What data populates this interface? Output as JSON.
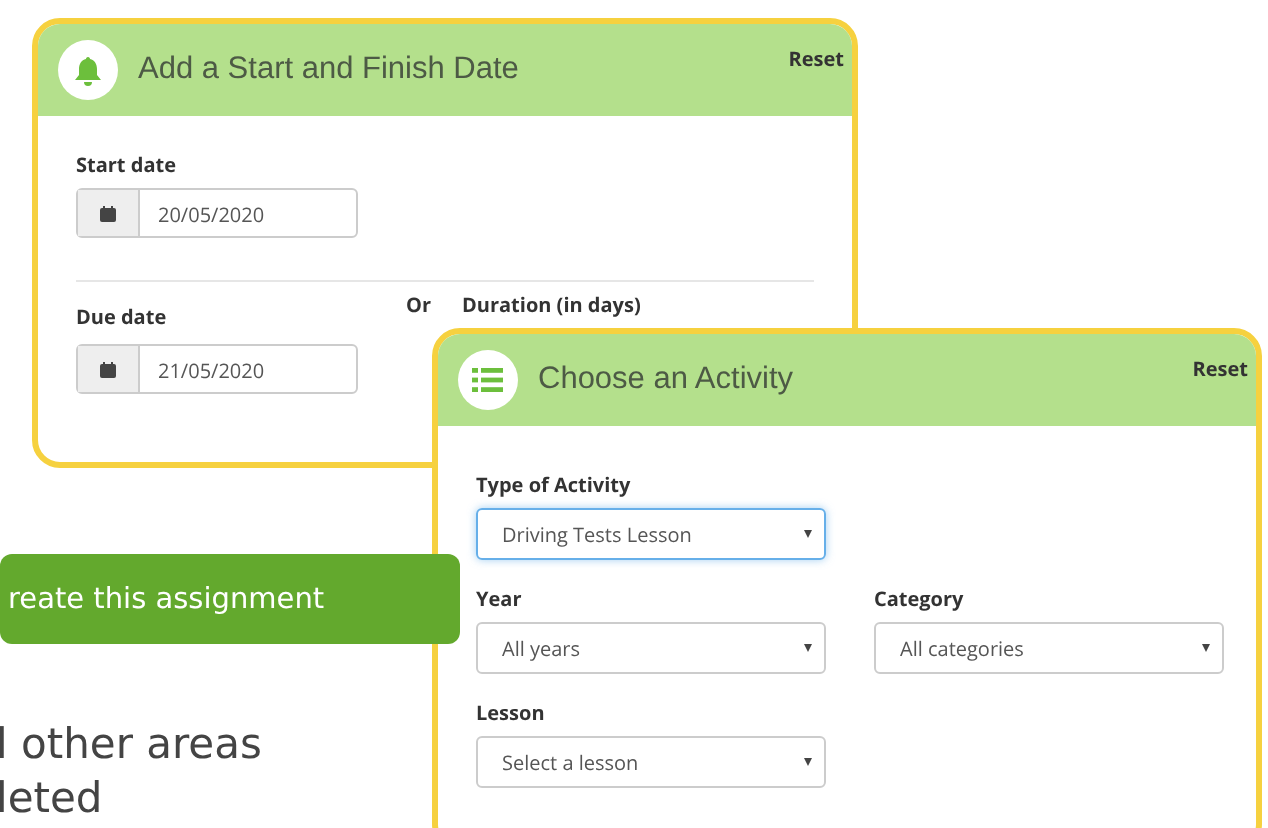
{
  "date_card": {
    "title": "Add a Start and Finish Date",
    "reset": "Reset",
    "start_label": "Start date",
    "start_value": "20/05/2020",
    "due_label": "Due date",
    "due_value": "21/05/2020",
    "or": "Or",
    "duration_label": "Duration (in days)"
  },
  "activity_card": {
    "title": "Choose an Activity",
    "reset": "Reset",
    "fields": [
      {
        "label": "Type of Activity",
        "value": "Driving Tests Lesson",
        "focused": true
      },
      {
        "label": "Year",
        "value": "All years",
        "focused": false
      },
      {
        "label": "Category",
        "value": "All categories",
        "focused": false
      },
      {
        "label": "Lesson",
        "value": "Select a lesson",
        "focused": false
      }
    ]
  },
  "create_button": "reate this assignment",
  "background_text": [
    "l other areas",
    "leted"
  ]
}
